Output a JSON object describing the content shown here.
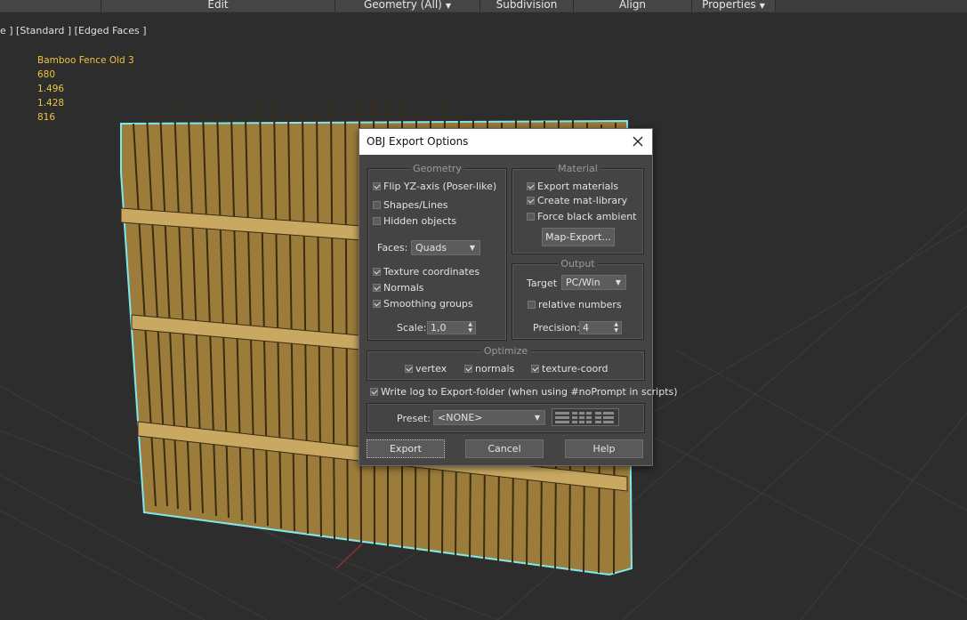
{
  "ribbon": {
    "items": [
      {
        "label": "Edit",
        "has_caret": false
      },
      {
        "label": "Geometry (All)",
        "has_caret": true
      },
      {
        "label": "Subdivision",
        "has_caret": false
      },
      {
        "label": "Align",
        "has_caret": false
      },
      {
        "label": "Properties",
        "has_caret": true
      }
    ]
  },
  "viewport": {
    "label": "e ] [Standard ] [Edged Faces ]",
    "stats": [
      "Bamboo Fence Old 3",
      "680",
      "1.496",
      "1.428",
      "816"
    ]
  },
  "dialog": {
    "title": "OBJ Export Options",
    "geometry": {
      "title": "Geometry",
      "flip_yz": {
        "label": "Flip YZ-axis (Poser-like)",
        "checked": true
      },
      "shapes_lines": {
        "label": "Shapes/Lines",
        "checked": false
      },
      "hidden_objects": {
        "label": "Hidden objects",
        "checked": false
      },
      "faces_label": "Faces:",
      "faces_value": "Quads",
      "texture_coords": {
        "label": "Texture coordinates",
        "checked": true
      },
      "normals": {
        "label": "Normals",
        "checked": true
      },
      "smoothing_groups": {
        "label": "Smoothing groups",
        "checked": true
      },
      "scale_label": "Scale:",
      "scale_value": "1,0"
    },
    "material": {
      "title": "Material",
      "export_materials": {
        "label": "Export materials",
        "checked": true
      },
      "create_mat_library": {
        "label": "Create mat-library",
        "checked": true
      },
      "force_black_ambient": {
        "label": "Force black ambient",
        "checked": false
      },
      "map_export_button": "Map-Export..."
    },
    "output": {
      "title": "Output",
      "target_label": "Target",
      "target_value": "PC/Win",
      "relative_numbers": {
        "label": "relative numbers",
        "checked": false
      },
      "precision_label": "Precision:",
      "precision_value": "4"
    },
    "optimize": {
      "title": "Optimize",
      "vertex": {
        "label": "vertex",
        "checked": true
      },
      "normals": {
        "label": "normals",
        "checked": true
      },
      "texture_coord": {
        "label": "texture-coord",
        "checked": true
      }
    },
    "write_log": {
      "label": "Write log to Export-folder (when using #noPrompt in scripts)",
      "checked": true
    },
    "preset": {
      "label": "Preset:",
      "value": "<NONE>"
    },
    "buttons": {
      "export": "Export",
      "cancel": "Cancel",
      "help": "Help"
    }
  },
  "colors": {
    "ribbon_bg": "#454545",
    "viewport_bg": "#2d2d2d",
    "dialog_bg": "#444444",
    "stats_text": "#f0c33c",
    "bamboo": "#b8954e",
    "selection_outline": "#7fe8ee"
  }
}
